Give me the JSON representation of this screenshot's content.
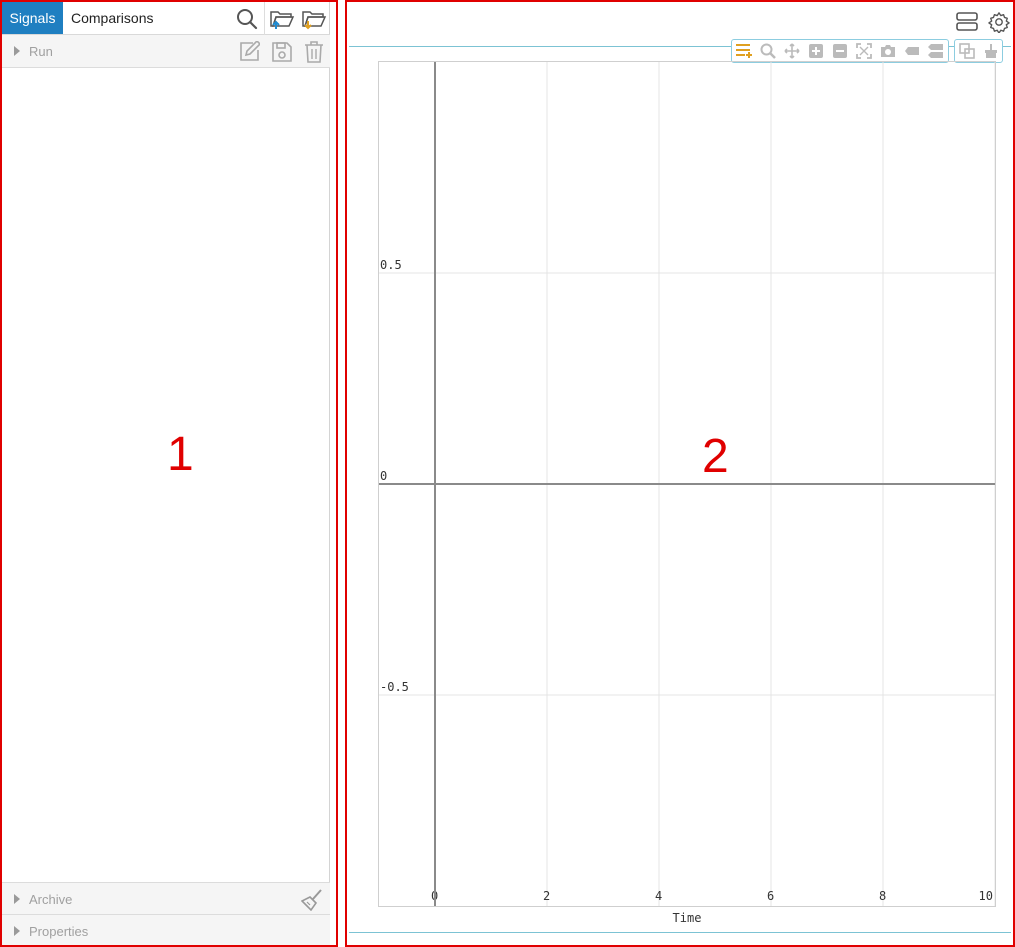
{
  "left_panel": {
    "tabs": [
      {
        "label": "Signals",
        "active": true
      },
      {
        "label": "Comparisons",
        "active": false
      }
    ],
    "toolbar_icons": [
      "search-icon",
      "folder-open-upload-icon",
      "folder-open-download-icon"
    ],
    "sections": {
      "run": {
        "label": "Run",
        "icons": [
          "edit-icon",
          "save-icon",
          "trash-icon"
        ]
      },
      "archive": {
        "label": "Archive",
        "icons": [
          "broom-icon"
        ]
      },
      "properties": {
        "label": "Properties"
      }
    },
    "badge": "1"
  },
  "right_panel": {
    "badge": "2",
    "corner_icons": [
      "layout-icon",
      "gear-icon"
    ],
    "plot_toolbar": [
      "legend-icon",
      "zoom-icon",
      "pan-icon",
      "zoom-in-icon",
      "zoom-out-icon",
      "fit-icon",
      "camera-icon",
      "cursor-icon",
      "data-cursors-icon",
      "copy-icon",
      "clear-icon"
    ],
    "accent_color": "#e0a020",
    "chart_data": {
      "type": "line",
      "xlabel": "Time",
      "ylabel": "",
      "title": "",
      "xlim": [
        0,
        10
      ],
      "ylim": [
        -1,
        1
      ],
      "x_ticks": [
        "0",
        "2",
        "4",
        "6",
        "8",
        "10"
      ],
      "y_ticks": [
        "0.5",
        "0",
        "-0.5"
      ],
      "grid": true,
      "series": []
    }
  }
}
